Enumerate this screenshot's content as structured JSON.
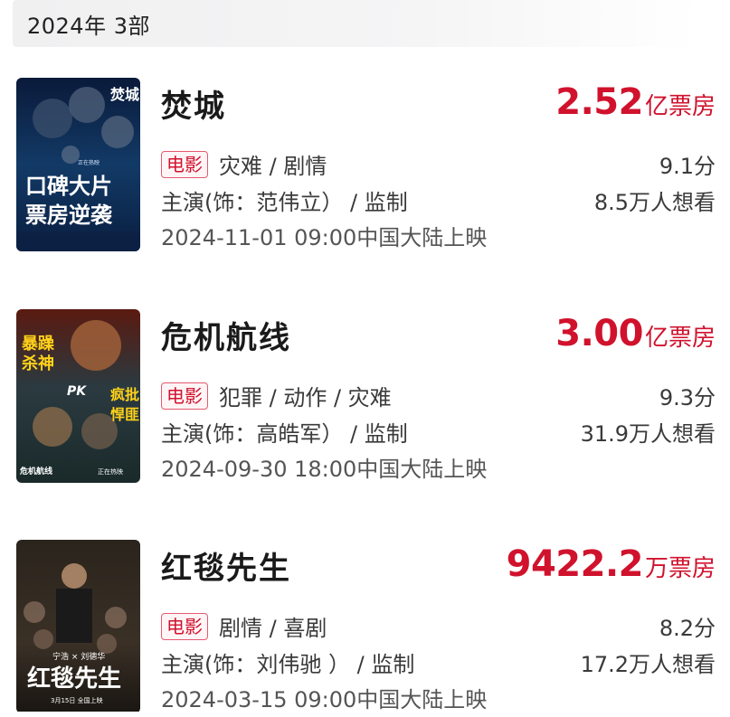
{
  "header": {
    "year_label": "2024年  3部"
  },
  "movies": [
    {
      "title": "焚城",
      "box_value": "2.52",
      "box_unit": "亿票房",
      "tag": "电影",
      "genres": "灾难 / 剧情",
      "cast": "主演(饰：范伟立）  / 监制",
      "release": "2024-11-01 09:00中国大陆上映",
      "score": "9.1分",
      "wants": "8.5万人想看",
      "poster_text": [
        "焚城",
        "口碑大片",
        "票房逆袭",
        "正在热映"
      ]
    },
    {
      "title": "危机航线",
      "box_value": "3.00",
      "box_unit": "亿票房",
      "tag": "电影",
      "genres": "犯罪 / 动作 / 灾难",
      "cast": "主演(饰：高皓军）  / 监制",
      "release": "2024-09-30 18:00中国大陆上映",
      "score": "9.3分",
      "wants": "31.9万人想看",
      "poster_text": [
        "暴躁杀神",
        "PK",
        "疯批悍匪",
        "危机航线",
        "正在热映"
      ]
    },
    {
      "title": "红毯先生",
      "box_value": "9422.2",
      "box_unit": "万票房",
      "tag": "电影",
      "genres": "剧情 / 喜剧",
      "cast": "主演(饰：刘伟驰 ）  / 监制",
      "release": "2024-03-15 09:00中国大陆上映",
      "score": "8.2分",
      "wants": "17.2万人想看",
      "poster_text": [
        "宁浩 × 刘德华",
        "红毯先生",
        "3月15日 全国上映"
      ]
    }
  ],
  "colors": {
    "accent": "#d0122d",
    "tag_border": "#e55a6e",
    "text": "#222222"
  }
}
